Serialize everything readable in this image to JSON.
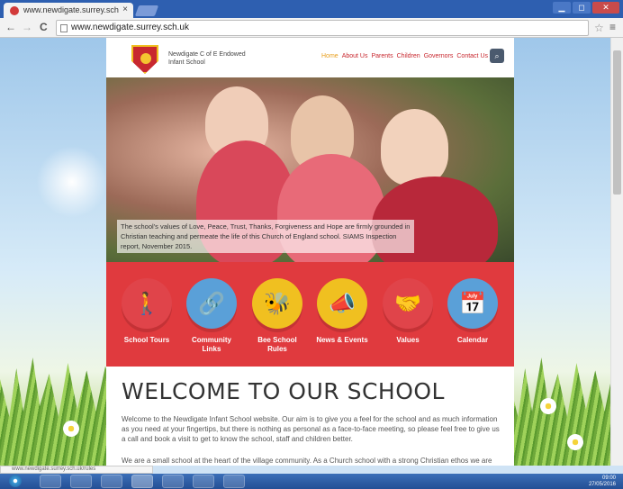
{
  "browser": {
    "tab_title": "www.newdigate.surrey.sch",
    "tab_close": "×",
    "nav_back": "←",
    "nav_forward": "→",
    "nav_reload": "C",
    "address": "www.newdigate.surrey.sch.uk",
    "star_icon": "☆",
    "menu_icon": "≡",
    "window_controls": [
      "▁",
      "◻",
      "✕"
    ],
    "status_url": "www.newdigate.surrey.sch.uk/rules"
  },
  "site": {
    "school_name": "Newdigate C of E Endowed Infant School",
    "nav": [
      "Home",
      "About Us",
      "Parents",
      "Children",
      "Governors",
      "Contact Us"
    ],
    "search_icon": "🔍",
    "hero_quote": "The school's values of Love, Peace, Trust, Thanks, Forgiveness and Hope are firmly grounded in Christian teaching and permeate the life of this Church of England school. SIAMS Inspection report, November 2015.",
    "tiles": [
      {
        "label": "School Tours",
        "icon": "🚶",
        "color": "#e0444a"
      },
      {
        "label": "Community Links",
        "icon": "🔗",
        "color": "#5aa0d8"
      },
      {
        "label": "Bee School Rules",
        "icon": "🐝",
        "color": "#f0c020"
      },
      {
        "label": "News & Events",
        "icon": "📣",
        "color": "#f0c020"
      },
      {
        "label": "Values",
        "icon": "🤝",
        "color": "#e0444a"
      },
      {
        "label": "Calendar",
        "icon": "📅",
        "color": "#5aa0d8"
      }
    ],
    "welcome_heading": "WELCOME TO OUR SCHOOL",
    "welcome_paragraph": "Welcome to the Newdigate Infant School website. Our aim is to give you a feel for the school and as much information as you need at your fingertips, but there is nothing as personal as a face-to-face meeting, so please feel free to give us a call and book a visit to get to know the school, staff and children better.",
    "welcome_paragraph2": "We are a small school at the heart of the village community. As a Church school with a strong Christian ethos we are"
  },
  "taskbar": {
    "time": "09:00",
    "date": "27/05/2016"
  }
}
